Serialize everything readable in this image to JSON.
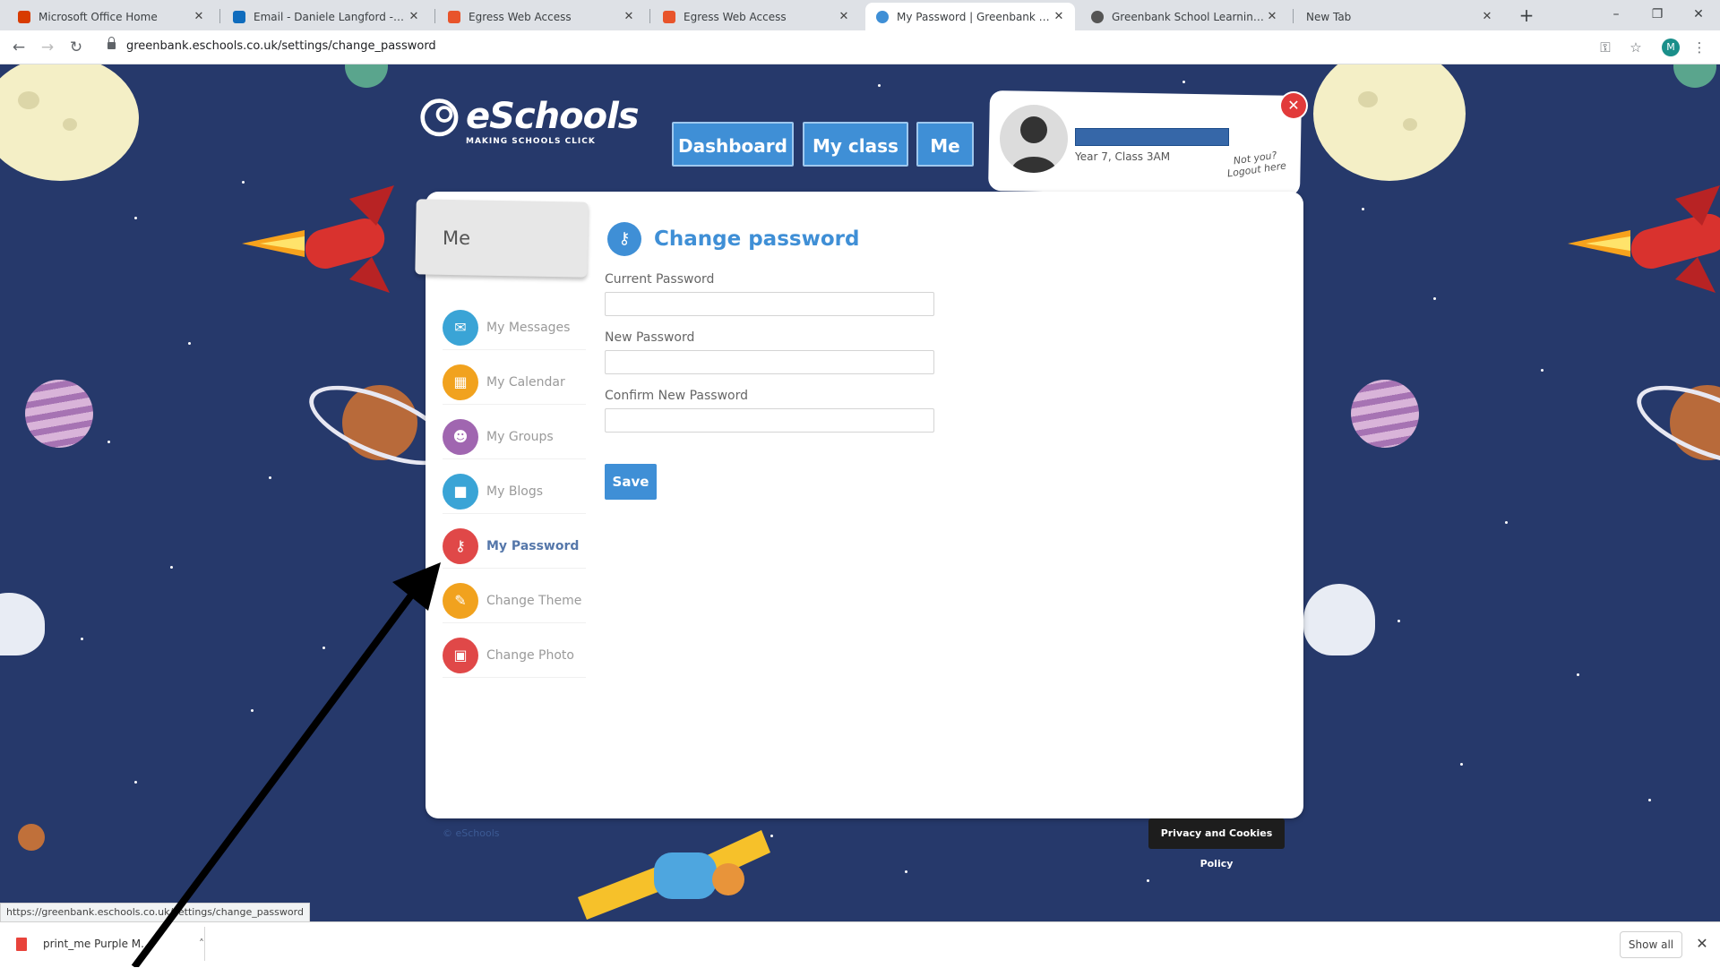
{
  "browser": {
    "tabs": [
      {
        "label": "Microsoft Office Home",
        "color": "#d83b01",
        "active": false
      },
      {
        "label": "Email - Daniele Langford - Outl",
        "color": "#0f6cbd",
        "active": false
      },
      {
        "label": "Egress Web Access",
        "color": "#e8542b",
        "active": false
      },
      {
        "label": "Egress Web Access",
        "color": "#e8542b",
        "active": false
      },
      {
        "label": "My Password | Greenbank School",
        "color": "#3f8fd6",
        "active": true
      },
      {
        "label": "Greenbank School Learning Re",
        "color": "#555555",
        "active": false
      },
      {
        "label": "New Tab",
        "color": "",
        "active": false
      }
    ],
    "url": "greenbank.eschools.co.uk/settings/change_password",
    "profile_initial": "M"
  },
  "header": {
    "logo_text": "eSchools",
    "logo_tagline": "MAKING SCHOOLS CLICK",
    "nav": [
      {
        "label": "Dashboard"
      },
      {
        "label": "My class"
      },
      {
        "label": "Me"
      }
    ],
    "user": {
      "class": "Year 7, Class 3AM",
      "logout_note": "Not you? Logout here"
    }
  },
  "sidebar": {
    "title": "Me",
    "items": [
      {
        "label": "My Messages",
        "icon": "envelope-icon",
        "glyph": "✉",
        "color": "#3aa4d6",
        "active": false
      },
      {
        "label": "My Calendar",
        "icon": "calendar-icon",
        "glyph": "▦",
        "color": "#f1a21e",
        "active": false
      },
      {
        "label": "My Groups",
        "icon": "groups-icon",
        "glyph": "☻",
        "color": "#a066b0",
        "active": false
      },
      {
        "label": "My Blogs",
        "icon": "blog-icon",
        "glyph": "■",
        "color": "#3aa4d6",
        "active": false
      },
      {
        "label": "My Password",
        "icon": "key-icon",
        "glyph": "⚷",
        "color": "#e04848",
        "active": true
      },
      {
        "label": "Change Theme",
        "icon": "pencil-icon",
        "glyph": "✎",
        "color": "#f1a21e",
        "active": false
      },
      {
        "label": "Change Photo",
        "icon": "photo-icon",
        "glyph": "▣",
        "color": "#e04848",
        "active": false
      }
    ]
  },
  "form": {
    "title": "Change password",
    "fields": [
      {
        "label": "Current Password",
        "value": ""
      },
      {
        "label": "New Password",
        "value": ""
      },
      {
        "label": "Confirm New Password",
        "value": ""
      }
    ],
    "save_label": "Save"
  },
  "footer": {
    "copyright": "© eSchools",
    "privacy_label": "Privacy and Cookies Policy"
  },
  "status_bar": {
    "url": "https://greenbank.eschools.co.uk/settings/change_password"
  },
  "downloads": {
    "file": "print_me Purple M...",
    "show_all": "Show all"
  },
  "colors": {
    "background": "#26396b",
    "accent": "#3f8fd6",
    "danger": "#e23a3a"
  }
}
